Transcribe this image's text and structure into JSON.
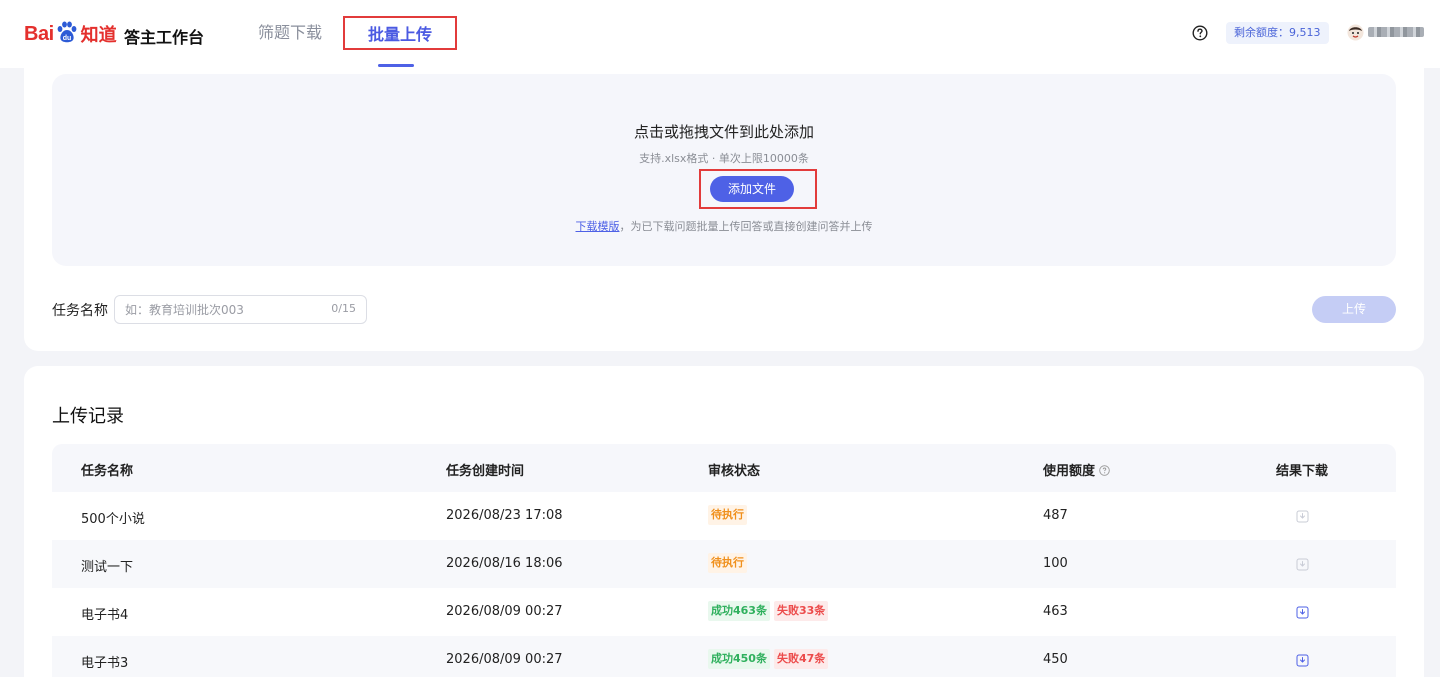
{
  "brand": {
    "logo_bai": "Bai",
    "logo_du": "du",
    "logo_zhidao": "知道",
    "app_title": "答主工作台",
    "color": "#e4302d"
  },
  "nav": {
    "tabs": [
      {
        "label": "筛题下载",
        "active": false
      },
      {
        "label": "批量上传",
        "active": true
      }
    ]
  },
  "header": {
    "quota_label": "剩余额度：9,513",
    "help_icon": "question-circle-icon",
    "avatar_icon": "user-avatar"
  },
  "upload": {
    "title": "点击或拖拽文件到此处添加",
    "subtitle": "支持.xlsx格式 · 单次上限10000条",
    "add_button": "添加文件",
    "template_link": "下载模版",
    "note": "，为已下载问题批量上传回答或直接创建问答并上传",
    "task_label": "任务名称",
    "task_placeholder": "如：教育培训批次003",
    "task_value": "",
    "task_count": "0/15",
    "upload_button": "上传"
  },
  "records": {
    "title": "上传记录",
    "columns": {
      "name": "任务名称",
      "time": "任务创建时间",
      "status": "审核状态",
      "quota": "使用额度",
      "download": "结果下载"
    },
    "rows": [
      {
        "name": "500个小说",
        "time": "2026/08/23 17:08",
        "tags": [
          {
            "text": "待执行",
            "kind": "pending"
          }
        ],
        "quota": "487",
        "download_enabled": false
      },
      {
        "name": "测试一下",
        "time": "2026/08/16 18:06",
        "tags": [
          {
            "text": "待执行",
            "kind": "pending"
          }
        ],
        "quota": "100",
        "download_enabled": false
      },
      {
        "name": "电子书4",
        "time": "2026/08/09 00:27",
        "tags": [
          {
            "text": "成功463条",
            "kind": "success"
          },
          {
            "text": "失败33条",
            "kind": "fail"
          }
        ],
        "quota": "463",
        "download_enabled": true
      },
      {
        "name": "电子书3",
        "time": "2026/08/09 00:27",
        "tags": [
          {
            "text": "成功450条",
            "kind": "success"
          },
          {
            "text": "失败47条",
            "kind": "fail"
          }
        ],
        "quota": "450",
        "download_enabled": true
      }
    ]
  },
  "colors": {
    "accent": "#4e61e6",
    "highlight_box": "#e23b3b",
    "pending": "#f0901c",
    "success": "#2fb05d",
    "fail": "#ec4b4b"
  }
}
